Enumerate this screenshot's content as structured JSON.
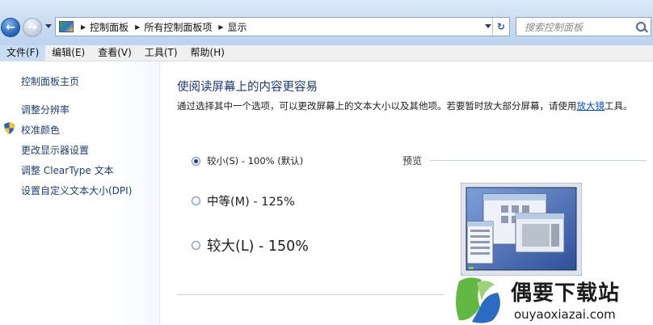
{
  "breadcrumb": [
    "控制面板",
    "所有控制面板项",
    "显示"
  ],
  "search": {
    "placeholder": "搜索控制面板"
  },
  "menu": [
    "文件(F)",
    "编辑(E)",
    "查看(V)",
    "工具(T)",
    "帮助(H)"
  ],
  "sidebar": {
    "items": [
      {
        "label": "控制面板主页"
      },
      {
        "label": "调整分辨率"
      },
      {
        "label": "校准颜色"
      },
      {
        "label": "更改显示器设置"
      },
      {
        "label": "调整 ClearType 文本"
      },
      {
        "label": "设置自定义文本大小(DPI)"
      }
    ]
  },
  "main": {
    "title": "使阅读屏幕上的内容更容易",
    "description_prefix": "通过选择其中一个选项，可以更改屏幕上的文本大小以及其他项。若要暂时放大部分屏幕，请使用",
    "description_link": "放大镜",
    "description_suffix": "工具。",
    "options": [
      {
        "label": "较小(S) - 100% (默认)",
        "checked": true
      },
      {
        "label": "中等(M) - 125%",
        "checked": false
      },
      {
        "label": "较大(L) - 150%",
        "checked": false
      }
    ],
    "preview_label": "预览"
  },
  "watermark": {
    "title": "偶要下载站",
    "url": "ouyaoxiazai.com"
  },
  "colors": {
    "accent": "#1e3973",
    "link": "#0a50b6",
    "nav_bg": "#c7daf1"
  },
  "icons": [
    "back-arrow-icon",
    "forward-arrow-icon",
    "control-panel-icon",
    "refresh-icon",
    "search-icon",
    "shield-icon"
  ]
}
